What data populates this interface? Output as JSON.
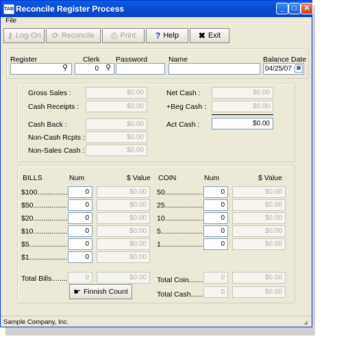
{
  "window": {
    "title": "Reconcile Register Process",
    "app_icon": "TAB"
  },
  "menu": {
    "file": "File"
  },
  "toolbar": {
    "logon": "Log-On",
    "reconcile": "Reconcile",
    "print": "Print",
    "help": "Help",
    "exit": "Exit"
  },
  "header": {
    "register_label": "Register",
    "register_value": "",
    "clerk_label": "Clerk",
    "clerk_value": "0",
    "password_label": "Password",
    "password_value": "",
    "name_label": "Name",
    "name_value": "",
    "balance_date_label": "Balance Date",
    "balance_date_value": "04/25/07"
  },
  "summary": {
    "gross_sales_label": "Gross Sales :",
    "gross_sales_value": "$0.00",
    "cash_receipts_label": "Cash Receipts :",
    "cash_receipts_value": "$0.00",
    "cash_back_label": "Cash Back :",
    "cash_back_value": "$0.00",
    "non_cash_rcpts_label": "Non-Cash Rcpts :",
    "non_cash_rcpts_value": "$0.00",
    "non_sales_cash_label": "Non-Sales Cash :",
    "non_sales_cash_value": "$0.00",
    "net_cash_label": "Net Cash :",
    "net_cash_value": "$0.00",
    "beg_cash_label": "+Beg Cash :",
    "beg_cash_value": "$0.00",
    "act_cash_label": "Act Cash :",
    "act_cash_value": "$0.00"
  },
  "bills": {
    "header": "BILLS",
    "num_header": "Num",
    "value_header": "$ Value",
    "rows": [
      {
        "label": "$100................",
        "num": "0",
        "value": "$0.00"
      },
      {
        "label": "$50.................",
        "num": "0",
        "value": "$0.00"
      },
      {
        "label": "$20.................",
        "num": "0",
        "value": "$0.00"
      },
      {
        "label": "$10.................",
        "num": "0",
        "value": "$0.00"
      },
      {
        "label": "$5...................",
        "num": "0",
        "value": "$0.00"
      },
      {
        "label": "$1...................",
        "num": "0",
        "value": "$0.00"
      }
    ],
    "total_label": "Total Bills.........",
    "total_num": "0",
    "total_value": "$0.00",
    "finish_button": "Finnish Count"
  },
  "coin": {
    "header": "COIN",
    "num_header": "Num",
    "value_header": "$ Value",
    "rows": [
      {
        "label": "50....................",
        "num": "0",
        "value": "$0.00"
      },
      {
        "label": "25....................",
        "num": "0",
        "value": "$0.00"
      },
      {
        "label": "10....................",
        "num": "0",
        "value": "$0.00"
      },
      {
        "label": "5......................",
        "num": "0",
        "value": "$0.00"
      },
      {
        "label": "1......................",
        "num": "0",
        "value": "$0.00"
      }
    ],
    "total_coin_label": "Total Coin.........",
    "total_coin_num": "0",
    "total_coin_value": "$0.00",
    "total_cash_label": "Total Cash.......",
    "total_cash_num": "0",
    "total_cash_value": "$0.00"
  },
  "status": {
    "company": "Sample Company, Inc."
  }
}
